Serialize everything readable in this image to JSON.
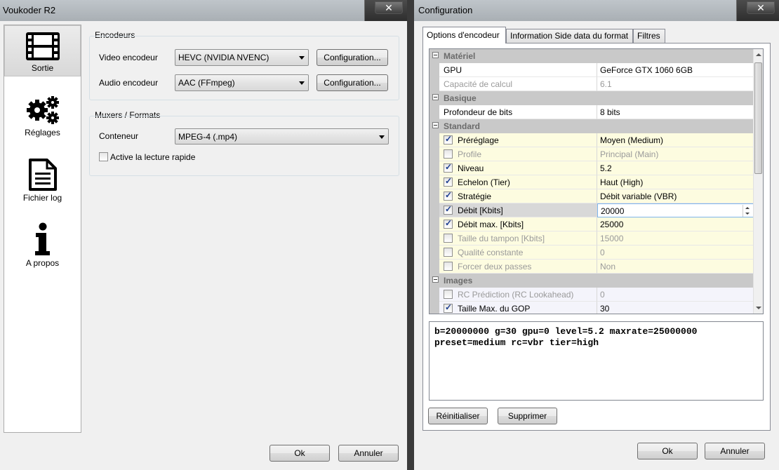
{
  "left_window": {
    "title": "Voukoder R2",
    "close_glyph": "✕",
    "sidebar": [
      {
        "label": "Sortie",
        "icon": "film-icon"
      },
      {
        "label": "Réglages",
        "icon": "gears-icon"
      },
      {
        "label": "Fichier log",
        "icon": "document-icon"
      },
      {
        "label": "A propos",
        "icon": "info-icon"
      }
    ],
    "encoders": {
      "group_label": "Encodeurs",
      "video_label": "Video encodeur",
      "video_value": "HEVC (NVIDIA NVENC)",
      "video_config": "Configuration...",
      "audio_label": "Audio encodeur",
      "audio_value": "AAC (FFmpeg)",
      "audio_config": "Configuration..."
    },
    "muxers": {
      "group_label": "Muxers / Formats",
      "container_label": "Conteneur",
      "container_value": "MPEG-4 (.mp4)",
      "faststart_label": "Active la lecture rapide"
    },
    "ok": "Ok",
    "cancel": "Annuler"
  },
  "right_window": {
    "title": "Configuration",
    "close_glyph": "✕",
    "tabs": [
      "Options d'encodeur",
      "Information Side data du format",
      "Filtres"
    ],
    "categories": {
      "materiel": "Matériel",
      "basique": "Basique",
      "standard": "Standard",
      "images": "Images"
    },
    "rows": [
      {
        "name": "GPU",
        "value": "GeForce GTX 1060 6GB"
      },
      {
        "name": "Capacité de calcul",
        "value": "6.1"
      },
      {
        "name": "Profondeur de bits",
        "value": "8 bits"
      },
      {
        "name": "Préréglage",
        "value": "Moyen (Medium)"
      },
      {
        "name": "Profile",
        "value": "Principal (Main)"
      },
      {
        "name": "Niveau",
        "value": "5.2"
      },
      {
        "name": "Echelon (Tier)",
        "value": "Haut (High)"
      },
      {
        "name": "Stratégie",
        "value": "Débit variable (VBR)"
      },
      {
        "name": "Débit [Kbits]",
        "value": "20000"
      },
      {
        "name": "Débit max. [Kbits]",
        "value": "25000"
      },
      {
        "name": "Taille du tampon [Kbits]",
        "value": "15000"
      },
      {
        "name": "Qualité constante",
        "value": "0"
      },
      {
        "name": "Forcer deux passes",
        "value": "Non"
      },
      {
        "name": "RC Prédiction (RC Lookahead)",
        "value": "0"
      },
      {
        "name": "Taille Max. du GOP",
        "value": "30"
      }
    ],
    "output_text": "b=20000000 g=30 gpu=0 level=5.2 maxrate=25000000\npreset=medium rc=vbr tier=high",
    "reset": "Réinitialiser",
    "delete": "Supprimer",
    "ok": "Ok",
    "cancel": "Annuler"
  }
}
